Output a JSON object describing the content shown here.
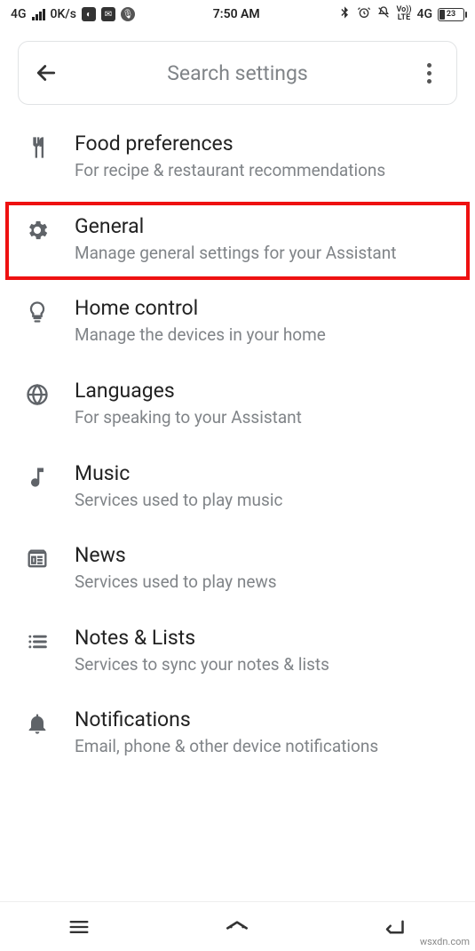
{
  "status": {
    "network": "4G",
    "speed": "0K/s",
    "time": "7:50 AM",
    "volte": "Vo))\nLTE",
    "net2": "4G",
    "battery_pct": "23"
  },
  "search": {
    "placeholder": "Search settings"
  },
  "items": [
    {
      "icon": "fork-knife-icon",
      "title": "Food preferences",
      "subtitle": "For recipe & restaurant recommendations",
      "highlighted": false
    },
    {
      "icon": "gear-icon",
      "title": "General",
      "subtitle": "Manage general settings for your Assistant",
      "highlighted": true
    },
    {
      "icon": "bulb-icon",
      "title": "Home control",
      "subtitle": "Manage the devices in your home",
      "highlighted": false
    },
    {
      "icon": "globe-icon",
      "title": "Languages",
      "subtitle": "For speaking to your Assistant",
      "highlighted": false
    },
    {
      "icon": "music-note-icon",
      "title": "Music",
      "subtitle": "Services used to play music",
      "highlighted": false
    },
    {
      "icon": "newspaper-icon",
      "title": "News",
      "subtitle": "Services used to play news",
      "highlighted": false
    },
    {
      "icon": "list-icon",
      "title": "Notes & Lists",
      "subtitle": "Services to sync your notes & lists",
      "highlighted": false
    },
    {
      "icon": "bell-icon",
      "title": "Notifications",
      "subtitle": "Email, phone & other device notifications",
      "highlighted": false
    }
  ],
  "watermark": "wsxdn.com"
}
